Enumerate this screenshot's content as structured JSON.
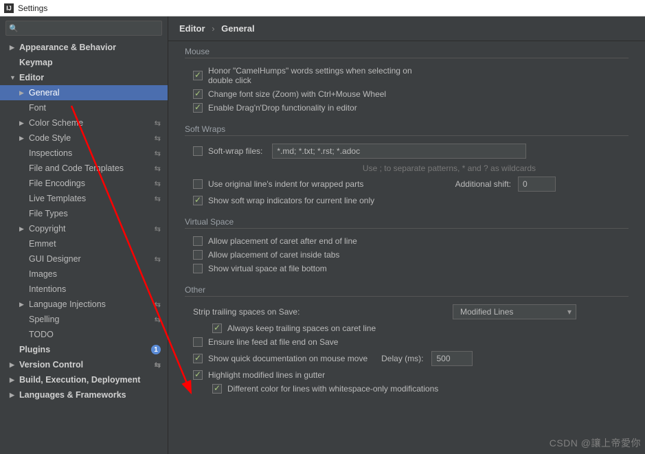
{
  "window": {
    "title": "Settings"
  },
  "search": {
    "placeholder": ""
  },
  "sidebar": {
    "items": [
      {
        "label": "Appearance & Behavior",
        "arrow": "▶",
        "bold": true,
        "lvl": 1
      },
      {
        "label": "Keymap",
        "arrow": "",
        "bold": true,
        "lvl": 1
      },
      {
        "label": "Editor",
        "arrow": "▼",
        "bold": true,
        "lvl": 1
      },
      {
        "label": "General",
        "arrow": "▶",
        "lvl": 2,
        "sel": true
      },
      {
        "label": "Font",
        "lvl": 2
      },
      {
        "label": "Color Scheme",
        "arrow": "▶",
        "lvl": 2,
        "sfx": "⮡"
      },
      {
        "label": "Code Style",
        "arrow": "▶",
        "lvl": 2,
        "sfx": "⮡"
      },
      {
        "label": "Inspections",
        "lvl": 2,
        "sfx": "⮡"
      },
      {
        "label": "File and Code Templates",
        "lvl": 2,
        "sfx": "⮡"
      },
      {
        "label": "File Encodings",
        "lvl": 2,
        "sfx": "⮡"
      },
      {
        "label": "Live Templates",
        "lvl": 2,
        "sfx": "⮡"
      },
      {
        "label": "File Types",
        "lvl": 2
      },
      {
        "label": "Copyright",
        "arrow": "▶",
        "lvl": 2,
        "sfx": "⮡"
      },
      {
        "label": "Emmet",
        "lvl": 2
      },
      {
        "label": "GUI Designer",
        "lvl": 2,
        "sfx": "⮡"
      },
      {
        "label": "Images",
        "lvl": 2
      },
      {
        "label": "Intentions",
        "lvl": 2
      },
      {
        "label": "Language Injections",
        "arrow": "▶",
        "lvl": 2,
        "sfx": "⮡"
      },
      {
        "label": "Spelling",
        "lvl": 2,
        "sfx": "⮡"
      },
      {
        "label": "TODO",
        "lvl": 2
      },
      {
        "label": "Plugins",
        "bold": true,
        "lvl": 1,
        "badge": "1"
      },
      {
        "label": "Version Control",
        "arrow": "▶",
        "bold": true,
        "lvl": 1,
        "sfx": "⮡"
      },
      {
        "label": "Build, Execution, Deployment",
        "arrow": "▶",
        "bold": true,
        "lvl": 1
      },
      {
        "label": "Languages & Frameworks",
        "arrow": "▶",
        "bold": true,
        "lvl": 1
      }
    ]
  },
  "breadcrumb": {
    "a": "Editor",
    "sep": "›",
    "b": "General"
  },
  "mouse": {
    "title": "Mouse",
    "honor": "Honor \"CamelHumps\" words settings when selecting on double click",
    "zoom": "Change font size (Zoom) with Ctrl+Mouse Wheel",
    "dnd": "Enable Drag'n'Drop functionality in editor"
  },
  "softwraps": {
    "title": "Soft Wraps",
    "files_lbl": "Soft-wrap files:",
    "files_val": "*.md; *.txt; *.rst; *.adoc",
    "hint": "Use ; to separate patterns, * and ? as wildcards",
    "indent": "Use original line's indent for wrapped parts",
    "addshift_lbl": "Additional shift:",
    "addshift_val": "0",
    "indicators": "Show soft wrap indicators for current line only"
  },
  "vspace": {
    "title": "Virtual Space",
    "eol": "Allow placement of caret after end of line",
    "tabs": "Allow placement of caret inside tabs",
    "bottom": "Show virtual space at file bottom"
  },
  "other": {
    "title": "Other",
    "strip_lbl": "Strip trailing spaces on Save:",
    "strip_val": "Modified Lines",
    "keep": "Always keep trailing spaces on caret line",
    "lf": "Ensure line feed at file end on Save",
    "quick": "Show quick documentation on mouse move",
    "delay_lbl": "Delay (ms):",
    "delay_val": "500",
    "gutter": "Highlight modified lines in gutter",
    "ws": "Different color for lines with whitespace-only modifications"
  },
  "watermark": "CSDN @讓上帝愛你"
}
